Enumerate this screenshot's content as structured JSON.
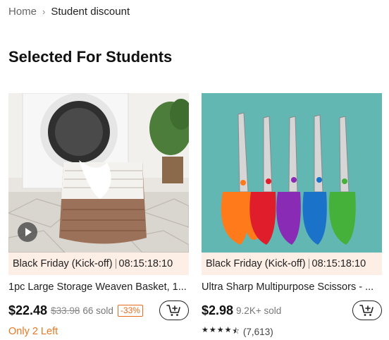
{
  "breadcrumb": {
    "home": "Home",
    "separator": "›",
    "current": "Student discount"
  },
  "page_title": "Selected For Students",
  "products": [
    {
      "promo_label": "Black Friday (Kick-off)",
      "countdown": "08:15:18:10",
      "title": "1pc Large Storage Weaven Basket, 1...",
      "price": "$22.48",
      "original_price": "$33.98",
      "sold": "66 sold",
      "discount": "-33%",
      "stock_note": "Only 2 Left",
      "image_icon": "woven-basket-image"
    },
    {
      "promo_label": "Black Friday (Kick-off)",
      "countdown": "08:15:18:10",
      "title": "Ultra Sharp Multipurpose Scissors - ...",
      "price": "$2.98",
      "sold": "9.2K+ sold",
      "rating_stars": 4.5,
      "rating_count": "(7,613)",
      "image_icon": "scissors-image"
    }
  ],
  "colors": {
    "promo_bg": "#fdeee6",
    "stock_orange": "#e87722",
    "discount_orange": "#e66b1e"
  }
}
